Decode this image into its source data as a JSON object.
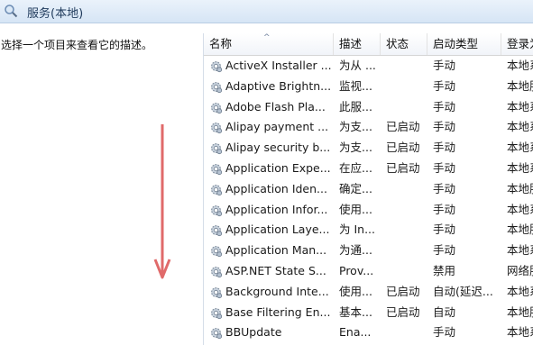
{
  "window": {
    "title": "服务(本地)",
    "icon": "services-magnifier-icon"
  },
  "left_pane": {
    "description_prompt": "选择一个项目来查看它的描述。"
  },
  "annotation": {
    "arrow_color": "#e06a6a",
    "direction": "down"
  },
  "table": {
    "columns": [
      "名称",
      "描述",
      "状态",
      "启动类型",
      "登录为"
    ],
    "sorted_column": "名称",
    "sort_indicator": "^",
    "rows": [
      {
        "name": "ActiveX Installer ...",
        "desc": "为从 ...",
        "status": "",
        "startup": "手动",
        "logon": "本地系"
      },
      {
        "name": "Adaptive Brightn...",
        "desc": "监视...",
        "status": "",
        "startup": "手动",
        "logon": "本地服"
      },
      {
        "name": "Adobe Flash Pla...",
        "desc": "此服...",
        "status": "",
        "startup": "手动",
        "logon": "本地系"
      },
      {
        "name": "Alipay payment ...",
        "desc": "为支...",
        "status": "已启动",
        "startup": "手动",
        "logon": "本地系"
      },
      {
        "name": "Alipay security b...",
        "desc": "为支...",
        "status": "已启动",
        "startup": "手动",
        "logon": "本地系"
      },
      {
        "name": "Application Expe...",
        "desc": "在应...",
        "status": "已启动",
        "startup": "手动",
        "logon": "本地系"
      },
      {
        "name": "Application Iden...",
        "desc": "确定...",
        "status": "",
        "startup": "手动",
        "logon": "本地服"
      },
      {
        "name": "Application Infor...",
        "desc": "使用...",
        "status": "",
        "startup": "手动",
        "logon": "本地系"
      },
      {
        "name": "Application Laye...",
        "desc": "为 In...",
        "status": "",
        "startup": "手动",
        "logon": "本地服"
      },
      {
        "name": "Application Man...",
        "desc": "为通...",
        "status": "",
        "startup": "手动",
        "logon": "本地系"
      },
      {
        "name": "ASP.NET State S...",
        "desc": "Prov...",
        "status": "",
        "startup": "禁用",
        "logon": "网络服"
      },
      {
        "name": "Background Inte...",
        "desc": "使用...",
        "status": "已启动",
        "startup": "自动(延迟...",
        "logon": "本地系"
      },
      {
        "name": "Base Filtering En...",
        "desc": "基本...",
        "status": "已启动",
        "startup": "自动",
        "logon": "本地服"
      },
      {
        "name": "BBUpdate",
        "desc": "Ena...",
        "status": "",
        "startup": "手动",
        "logon": "本地系"
      }
    ],
    "row_icon": "gear-service-icon"
  }
}
